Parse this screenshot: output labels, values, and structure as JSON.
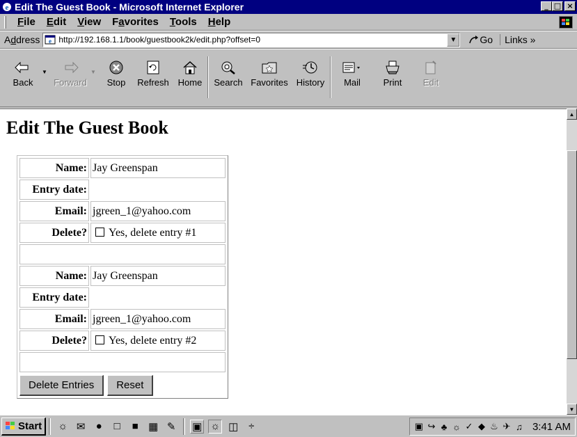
{
  "window": {
    "title": "Edit The Guest Book - Microsoft Internet Explorer"
  },
  "menu": [
    {
      "accel": "F",
      "rest": "ile"
    },
    {
      "accel": "E",
      "rest": "dit"
    },
    {
      "accel": "V",
      "rest": "iew"
    },
    {
      "pre": "F",
      "accel": "a",
      "rest": "vorites"
    },
    {
      "accel": "T",
      "rest": "ools"
    },
    {
      "accel": "H",
      "rest": "elp"
    }
  ],
  "address": {
    "label_pre": "A",
    "label_accel": "d",
    "label_rest": "dress",
    "url": "http://192.168.1.1/book/guestbook2k/edit.php?offset=0",
    "go_label": "Go",
    "links_label": "Links"
  },
  "toolbar": {
    "back": "Back",
    "forward": "Forward",
    "stop": "Stop",
    "refresh": "Refresh",
    "home": "Home",
    "search": "Search",
    "favorites": "Favorites",
    "history": "History",
    "mail": "Mail",
    "print": "Print",
    "edit": "Edit"
  },
  "page": {
    "heading": "Edit The Guest Book",
    "labels": {
      "name": "Name:",
      "entry_date": "Entry date:",
      "email": "Email:",
      "delete": "Delete?"
    },
    "entries": [
      {
        "name": "Jay Greenspan",
        "entry_date": "",
        "email": "jgreen_1@yahoo.com",
        "delete_label": "Yes, delete entry #1"
      },
      {
        "name": "Jay Greenspan",
        "entry_date": "",
        "email": "jgreen_1@yahoo.com",
        "delete_label": "Yes, delete entry #2"
      }
    ],
    "delete_button": "Delete Entries",
    "reset_button": "Reset"
  },
  "taskbar": {
    "start": "Start",
    "clock": "3:41 AM"
  }
}
